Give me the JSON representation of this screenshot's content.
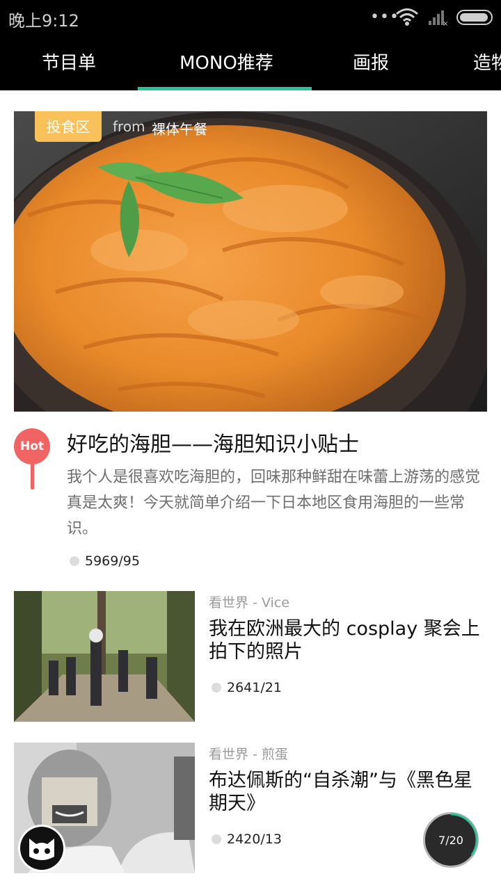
{
  "status_bar": {
    "time": "晚上9:12",
    "dots": "•••"
  },
  "tabs": [
    {
      "label": "节目单"
    },
    {
      "label": "MONO推荐"
    },
    {
      "label": "画报"
    },
    {
      "label": "造物"
    }
  ],
  "active_tab": "MONO推荐",
  "colors": {
    "accent": "#2dbf96",
    "category_badge": "#f9c15a",
    "hot": "#f06464"
  },
  "feature": {
    "category": "投食区",
    "from_label": "from",
    "source": "裸体午餐",
    "hot_label": "Hot",
    "title": "好吃的海胆——海胆知识小贴士",
    "description": "我个人是很喜欢吃海胆的，回味那种鲜甜在味蕾上游荡的感觉真是太爽！今天就简单介绍一下日本地区食用海胆的一些常识。",
    "stats": "5969/95"
  },
  "items": [
    {
      "source": "看世界 - Vice",
      "title": "我在欧洲最大的 cosplay 聚会上拍下的照片",
      "stats": "2641/21"
    },
    {
      "source": "看世界 - 煎蛋",
      "title": "布达佩斯的“自杀潮”与《黑色星期天》",
      "stats": "2420/13"
    }
  ],
  "pager": {
    "text": "7/20",
    "progress": 0.35
  }
}
